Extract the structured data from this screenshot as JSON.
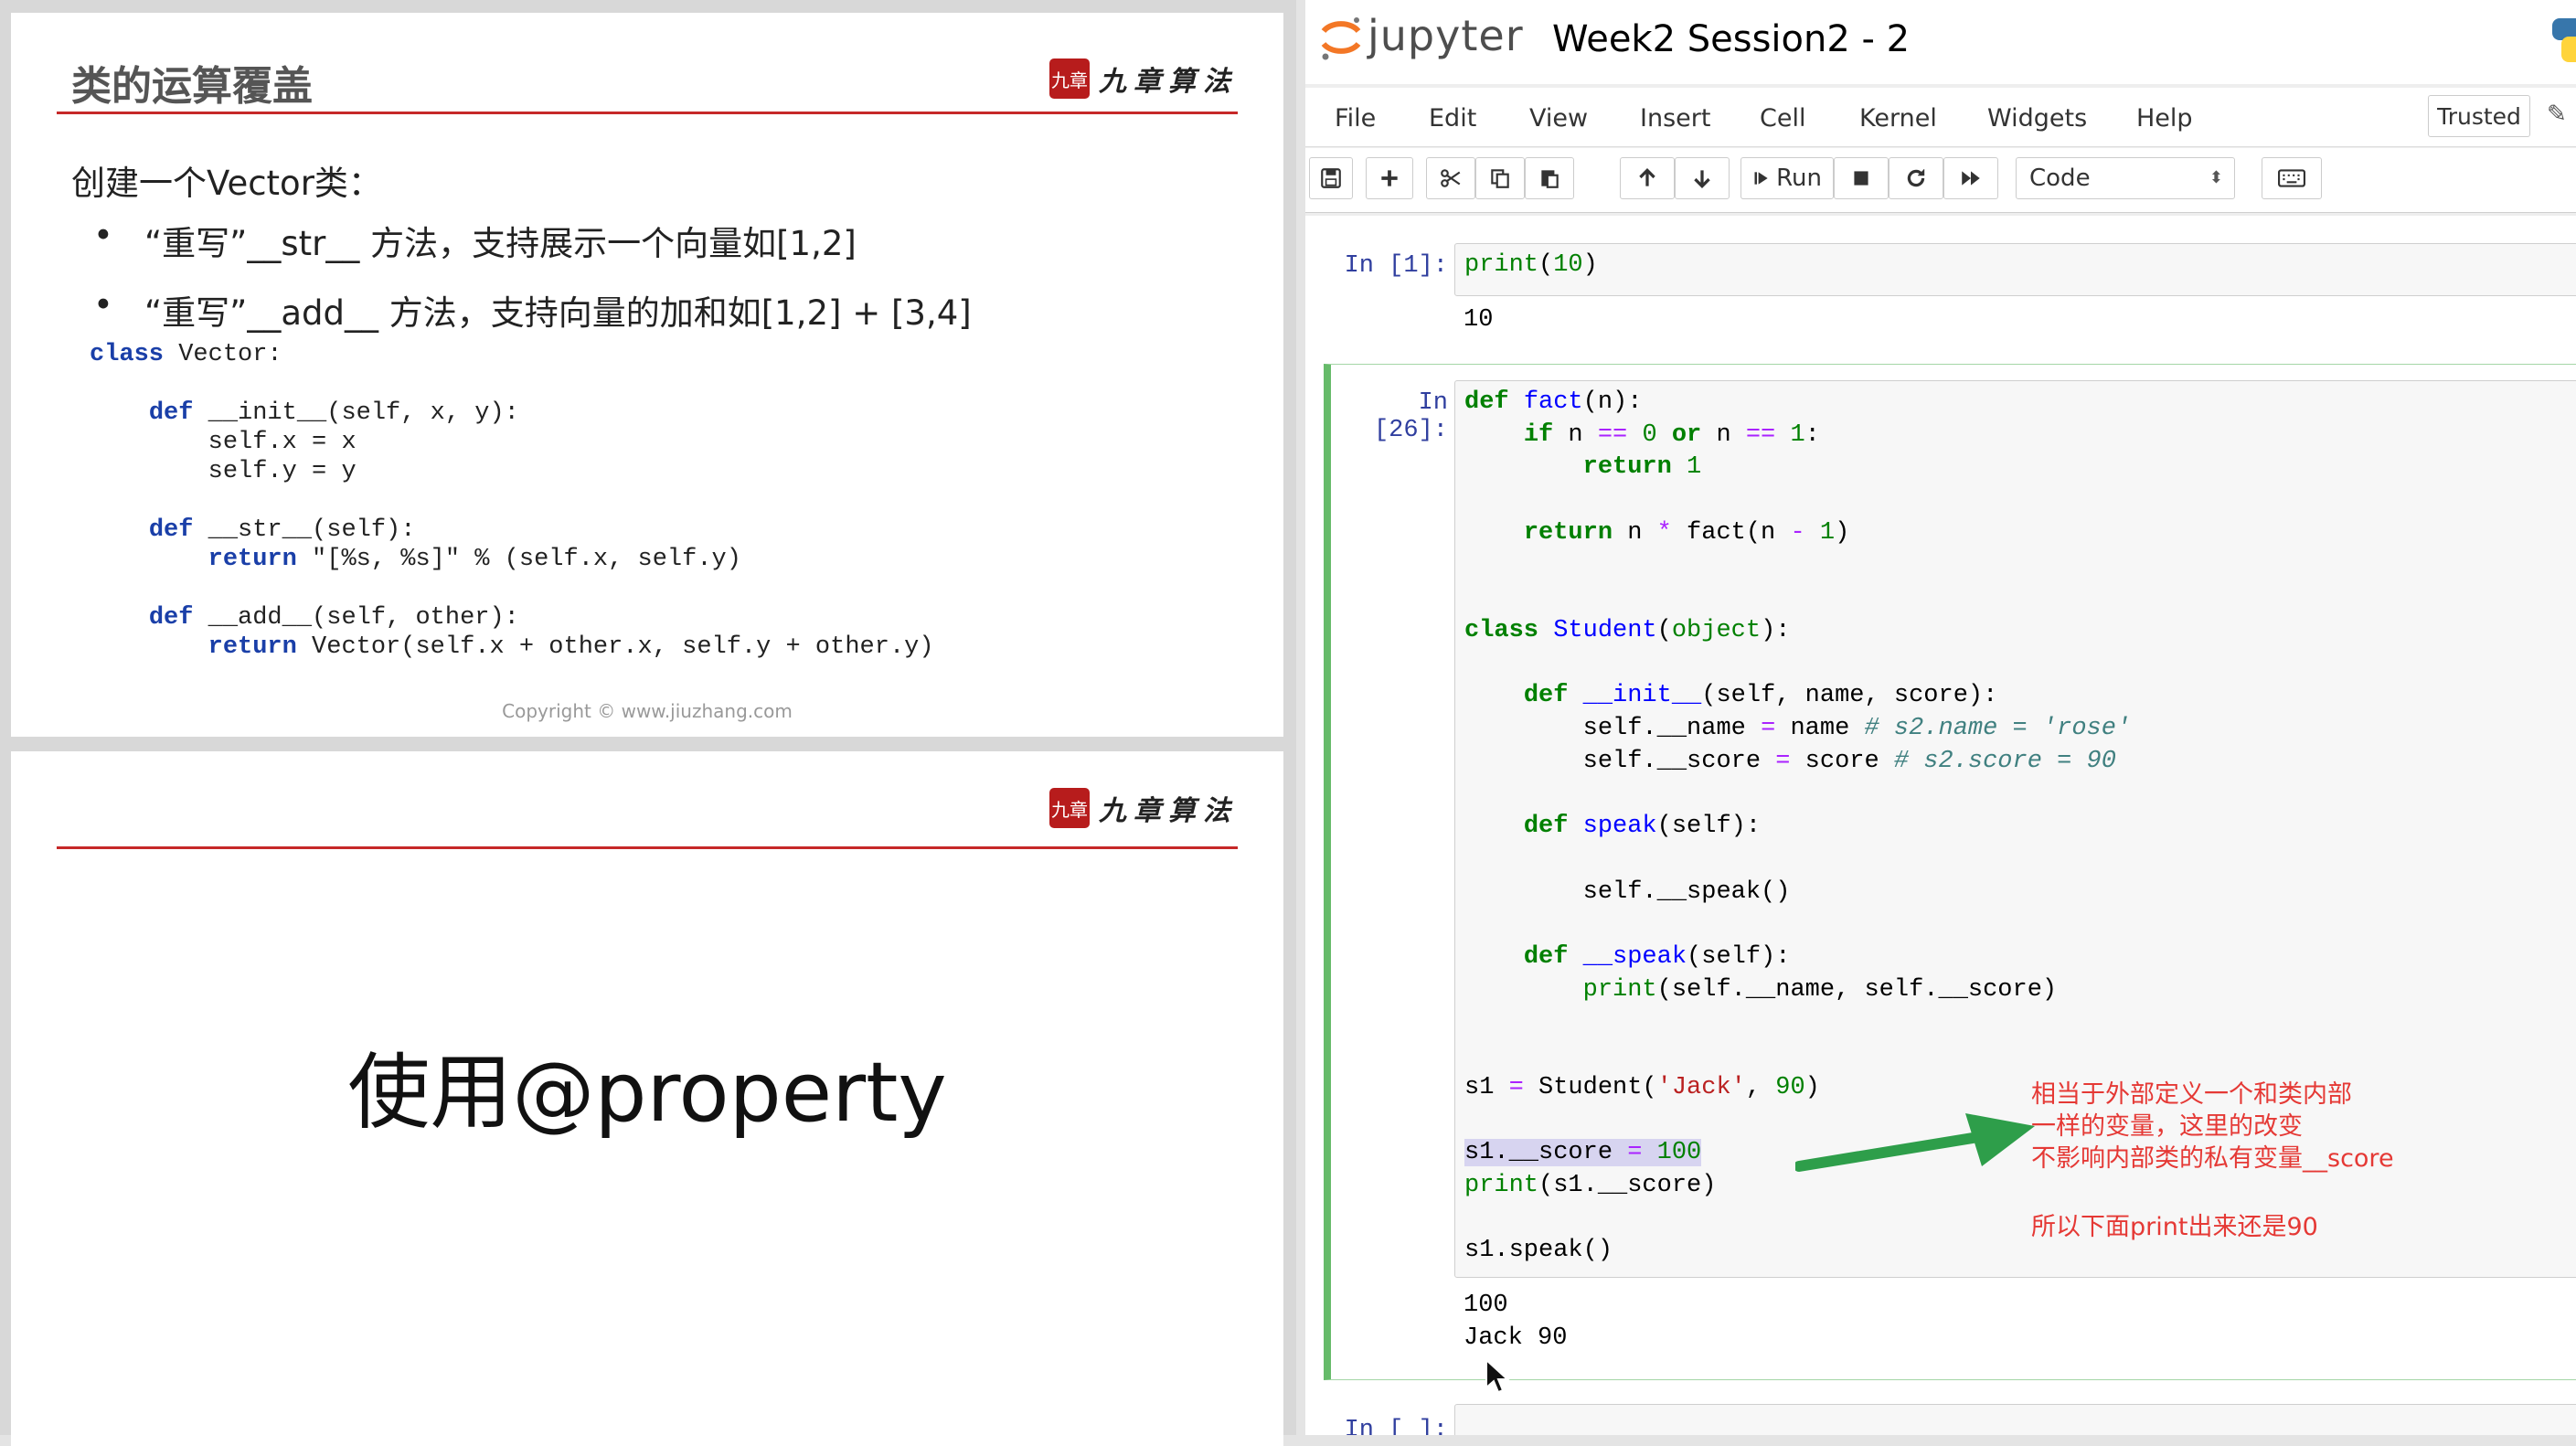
{
  "slide1": {
    "title": "类的运算覆盖",
    "logo_seal": "九章",
    "logo_text": "九章算法",
    "intro": "创建一个Vector类：",
    "bullets": [
      "“重写”__str__ 方法，支持展示一个向量如[1,2]",
      "“重写”__add__ 方法，支持向量的加和如[1,2] + [3,4]"
    ],
    "code": {
      "l1_kw": "class",
      "l1": " Vector:",
      "l3_kw": "def",
      "l3": " __init__(self, x, y):",
      "l4": "self.x = x",
      "l5": "self.y = y",
      "l7_kw": "def",
      "l7": " __str__(self):",
      "l8_kw": "return",
      "l8": " \"[%s, %s]\" % (self.x, self.y)",
      "l10_kw": "def",
      "l10": " __add__(self, other):",
      "l11_kw": "return",
      "l11": " Vector(self.x + other.x, self.y + other.y)"
    },
    "copyright": "Copyright © www.jiuzhang.com"
  },
  "slide2": {
    "logo_seal": "九章",
    "logo_text": "九章算法",
    "headline": "使用@property"
  },
  "jupyter": {
    "brand": "jupyter",
    "notebook_title": "Week2 Session2 - 2",
    "menu": [
      "File",
      "Edit",
      "View",
      "Insert",
      "Cell",
      "Kernel",
      "Widgets",
      "Help"
    ],
    "trusted": "Trusted",
    "run_label": "Run",
    "cell_type": "Code",
    "cell1": {
      "prompt": "In [1]:",
      "output": "10"
    },
    "cell2": {
      "prompt": "In [26]:",
      "outputs": [
        "100",
        "Jack 90"
      ],
      "comment1": "# s2.name = 'rose'",
      "comment2": "# s2.score = 90"
    },
    "cell3": {
      "prompt": "In [ ]:"
    },
    "annotation": {
      "lines": [
        "相当于外部定义一个和类内部",
        "一样的变量，这里的改变",
        "不影响内部类的私有变量__score"
      ],
      "note": "所以下面print出来还是90",
      "color": "#e53935"
    }
  }
}
